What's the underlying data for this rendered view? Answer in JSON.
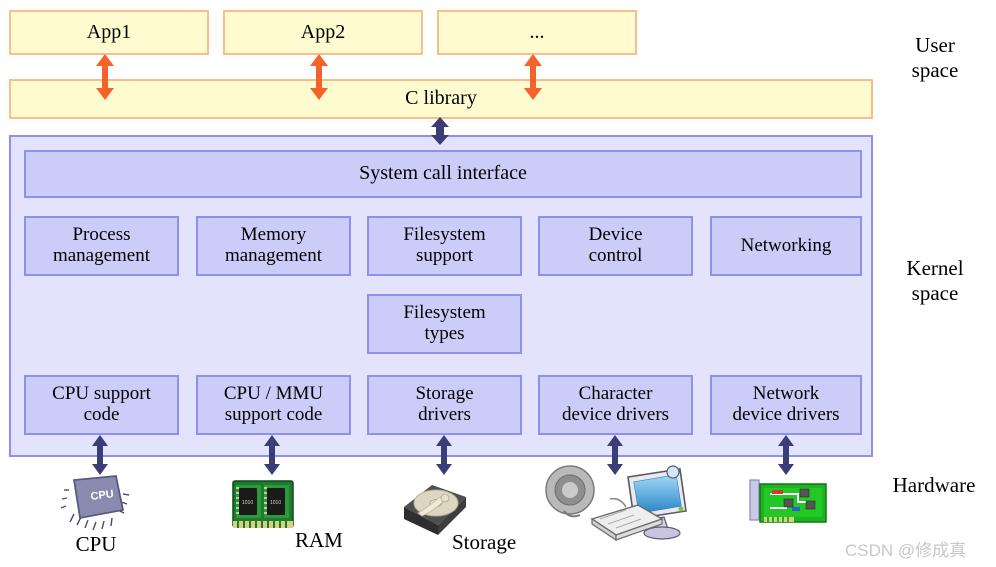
{
  "diagram": {
    "title": "Linux kernel architecture layers",
    "colors": {
      "user_fill": "#fdfbcf",
      "user_border": "#f7be8a",
      "kernel_outer_fill": "#e3e3fb",
      "kernel_inner_fill": "#ccccf8",
      "kernel_border": "#8f8ff0",
      "orange_arrow": "#f4642a",
      "blue_arrow": "#3c3c78",
      "watermark": "#c8c8c8"
    }
  },
  "user_space": {
    "apps": [
      {
        "label": "App1"
      },
      {
        "label": "App2"
      },
      {
        "label": "..."
      }
    ],
    "c_library": {
      "label": "C library"
    }
  },
  "kernel_space": {
    "syscall": {
      "label": "System call interface"
    },
    "subsystems": [
      {
        "label": "Process management",
        "line1": "Process",
        "line2": "management"
      },
      {
        "label": "Memory management",
        "line1": "Memory",
        "line2": "management"
      },
      {
        "label": "Filesystem support",
        "line1": "Filesystem",
        "line2": "support"
      },
      {
        "label": "Device control",
        "line1": "Device",
        "line2": "control"
      },
      {
        "label": "Networking",
        "line1": "Networking",
        "line2": ""
      }
    ],
    "filesystem_types": {
      "line1": "Filesystem",
      "line2": "types"
    },
    "drivers": [
      {
        "label": "CPU support code",
        "line1": "CPU support",
        "line2": "code"
      },
      {
        "label": "CPU / MMU support code",
        "line1": "CPU / MMU",
        "line2": "support code"
      },
      {
        "label": "Storage drivers",
        "line1": "Storage",
        "line2": "drivers"
      },
      {
        "label": "Character device drivers",
        "line1": "Character",
        "line2": "device drivers"
      },
      {
        "label": "Network device drivers",
        "line1": "Network",
        "line2": "device drivers"
      }
    ]
  },
  "hardware": {
    "devices": [
      {
        "label": "CPU",
        "icon": "cpu-chip-icon"
      },
      {
        "label": "RAM",
        "icon": "ram-module-icon"
      },
      {
        "label": "Storage",
        "icon": "hard-disk-icon"
      },
      {
        "label": "",
        "icon": "speaker-keyboard-monitor-icon"
      },
      {
        "label": "",
        "icon": "network-card-icon"
      }
    ]
  },
  "side_labels": {
    "user": {
      "line1": "User",
      "line2": "space"
    },
    "kernel": {
      "line1": "Kernel",
      "line2": "space"
    },
    "hardware": {
      "line1": "Hardware",
      "line2": ""
    }
  },
  "watermark": {
    "text": "CSDN @修成真"
  }
}
